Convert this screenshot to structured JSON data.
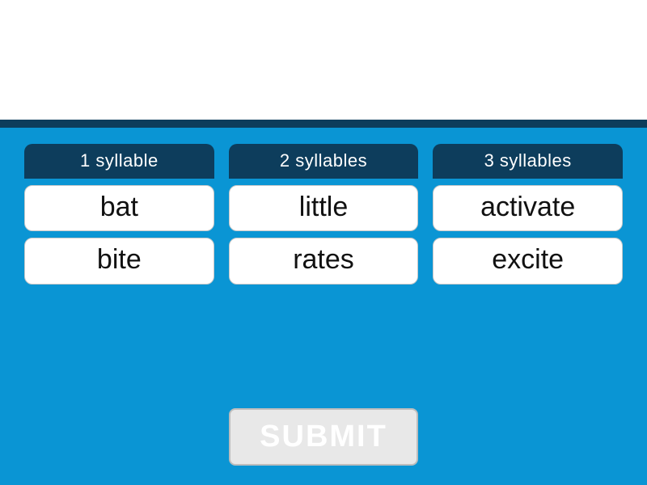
{
  "columns": [
    {
      "header": "1 syllable",
      "cards": [
        "bat",
        "bite"
      ]
    },
    {
      "header": "2 syllables",
      "cards": [
        "little",
        "rates"
      ]
    },
    {
      "header": "3 syllables",
      "cards": [
        "activate",
        "excite"
      ]
    }
  ],
  "submit_label": "SUBMIT",
  "colors": {
    "board_bg": "#0a95d4",
    "header_bg": "#0d3d5c",
    "card_bg": "#ffffff"
  }
}
